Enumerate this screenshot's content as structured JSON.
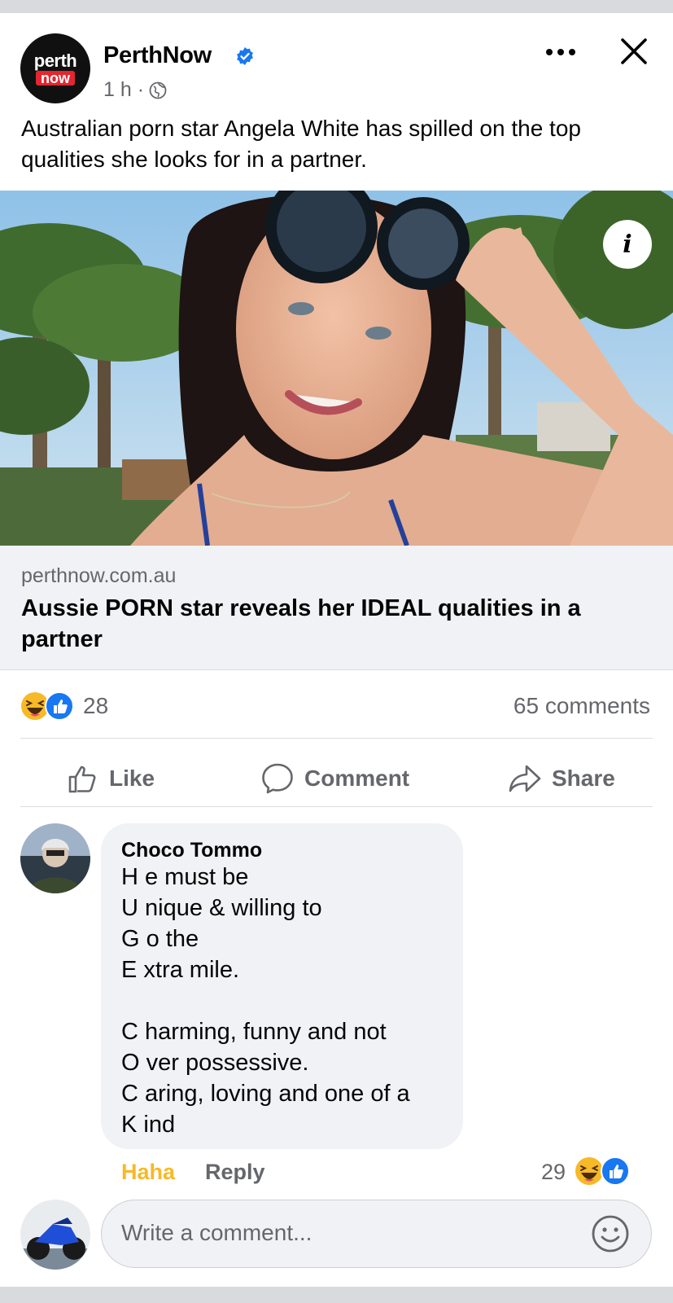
{
  "post": {
    "page_logo": {
      "line1": "perth",
      "line2": "now"
    },
    "page_name": "PerthNow",
    "time": "1 h ·",
    "text": "Australian porn star Angela White has spilled on the top qualities she looks for in a partner.",
    "info_label": "i"
  },
  "link": {
    "domain": "perthnow.com.au",
    "title": "Aussie PORN star reveals her IDEAL qualities in a partner"
  },
  "stats": {
    "reaction_count": "28",
    "comments": "65 comments"
  },
  "actions": {
    "like": "Like",
    "comment": "Comment",
    "share": "Share"
  },
  "comment": {
    "author": "Choco Tommo",
    "lines": [
      "H e must be",
      "U nique & willing to",
      "G o the",
      "E xtra mile.",
      "",
      "C harming, funny and not",
      "O ver possessive.",
      "C aring, loving and one of a",
      "K ind"
    ],
    "haha_label": "Haha",
    "reply_label": "Reply",
    "reaction_count": "29"
  },
  "composer": {
    "placeholder": "Write a comment..."
  },
  "colors": {
    "fb_blue": "#1877f2",
    "haha_yellow": "#f7b928",
    "muted_text": "#65676b",
    "bubble_bg": "#f0f2f5"
  }
}
